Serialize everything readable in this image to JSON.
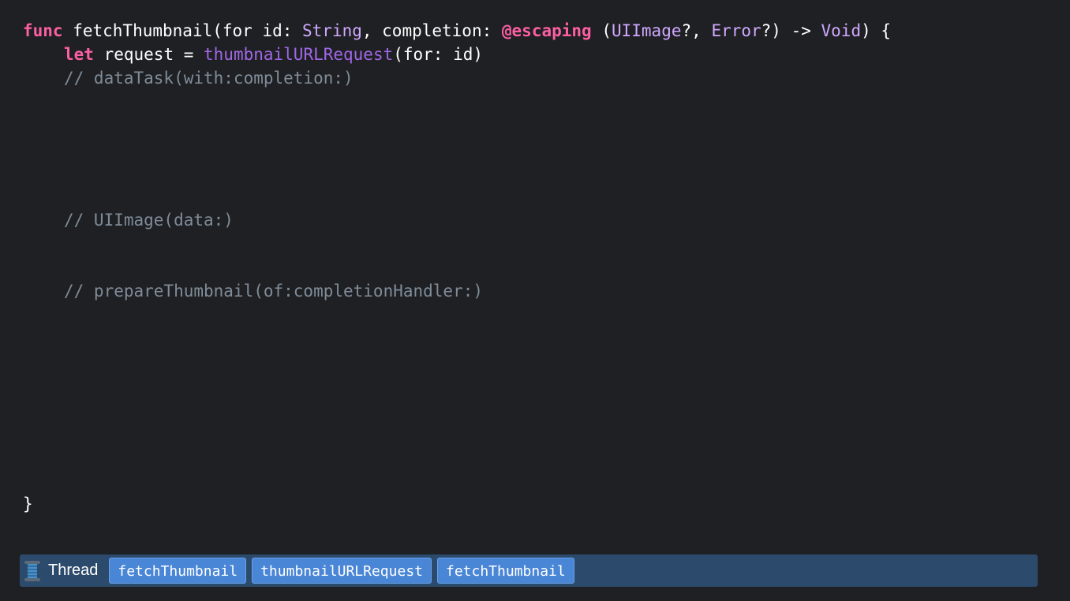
{
  "code": {
    "line1": {
      "kw_func": "func",
      "name": " fetchThumbnail(for id: ",
      "type_string": "String",
      "mid": ", completion: ",
      "kw_escaping": "@escaping",
      "open": " (",
      "type_uiimage": "UIImage",
      "comma": "?, ",
      "type_error": "Error",
      "arrow": "?) -> ",
      "type_void": "Void",
      "end": ") {"
    },
    "line2": {
      "kw_let": "let",
      "assign": " request = ",
      "call": "thumbnailURLRequest",
      "args": "(for: id)"
    },
    "comment1": "// dataTask(with:completion:)",
    "comment2": "// UIImage(data:)",
    "comment3": "// prepareThumbnail(of:completionHandler:)",
    "closing": "}"
  },
  "thread_bar": {
    "icon": "spool-icon",
    "label": "Thread",
    "frames": [
      "fetchThumbnail",
      "thumbnailURLRequest",
      "fetchThumbnail"
    ]
  },
  "colors": {
    "background": "#1f2023",
    "keyword": "#fc5fa3",
    "type": "#d0a8ff",
    "function": "#a167e6",
    "comment": "#7f8c98",
    "thread_bar": "#2c4a6b",
    "frame_button": "#4a86d6"
  }
}
